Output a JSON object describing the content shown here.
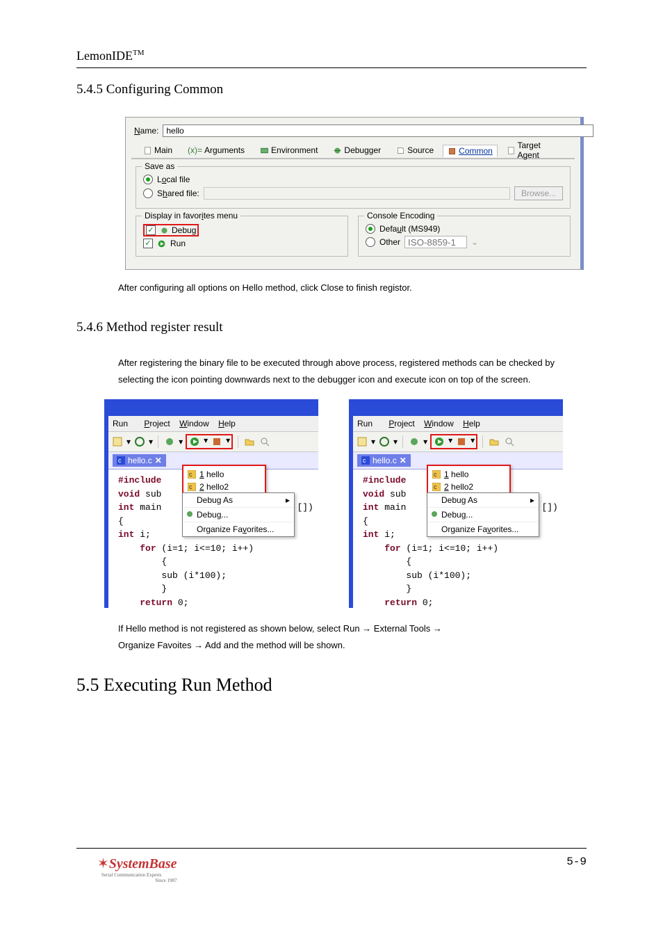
{
  "doc": {
    "brand": "LemonIDE",
    "brand_tm": "TM",
    "h545": "5.4.5 Configuring Common",
    "p545": "After configuring all options on  Hello  method, click  Close  to finish registor.",
    "h546": "5.4.6 Method register result",
    "p546": "After registering the binary file to be executed through above process, registered methods can be checked by selecting the icon pointing downwards next to the debugger icon and execute icon on top of the screen.",
    "p_note_l1": "If  Hello  method is not registered as shown below, select  Run  →  External Tools  →",
    "p_note_l2": " Organize Favoites  →  Add  and the method will be shown.",
    "h55": "5.5 Executing Run Method",
    "page_num": "5-9",
    "logo": "SystemBase",
    "logo_sub1": "Serial Communication Experts",
    "logo_sub2": "Since 1987"
  },
  "dialog": {
    "name_label": "Name:",
    "name_value": "hello",
    "tabs": {
      "main": "Main",
      "args": "Arguments",
      "env": "Environment",
      "debugger": "Debugger",
      "source": "Source",
      "common": "Common",
      "target": "Target Agent"
    },
    "saveas": {
      "title": "Save as",
      "local": "Local file",
      "shared": "Shared file:",
      "browse": "Browse..."
    },
    "fav": {
      "title": "Display in favorites menu",
      "debug": "Debug",
      "run": "Run"
    },
    "enc": {
      "title": "Console Encoding",
      "default": "Default (MS949)",
      "other": "Other",
      "other_placeholder": "ISO-8859-1"
    }
  },
  "ide": {
    "menus": {
      "run": "Run",
      "project": "Project",
      "window": "Window",
      "help": "Help"
    },
    "editor_tab": "hello.c",
    "drop": {
      "i1": "1 hello",
      "i2": "2 hello2"
    },
    "ctx": {
      "debug_as": "Debug As",
      "debug": "Debug...",
      "org_fav": "Organize Favorites..."
    },
    "code": "#include\nvoid sub\nint main                          [])\n{\nint i;\n    for (i=1; i<=10; i++)\n        {\n        sub (i*100);\n        }\n    return 0;\n}"
  }
}
